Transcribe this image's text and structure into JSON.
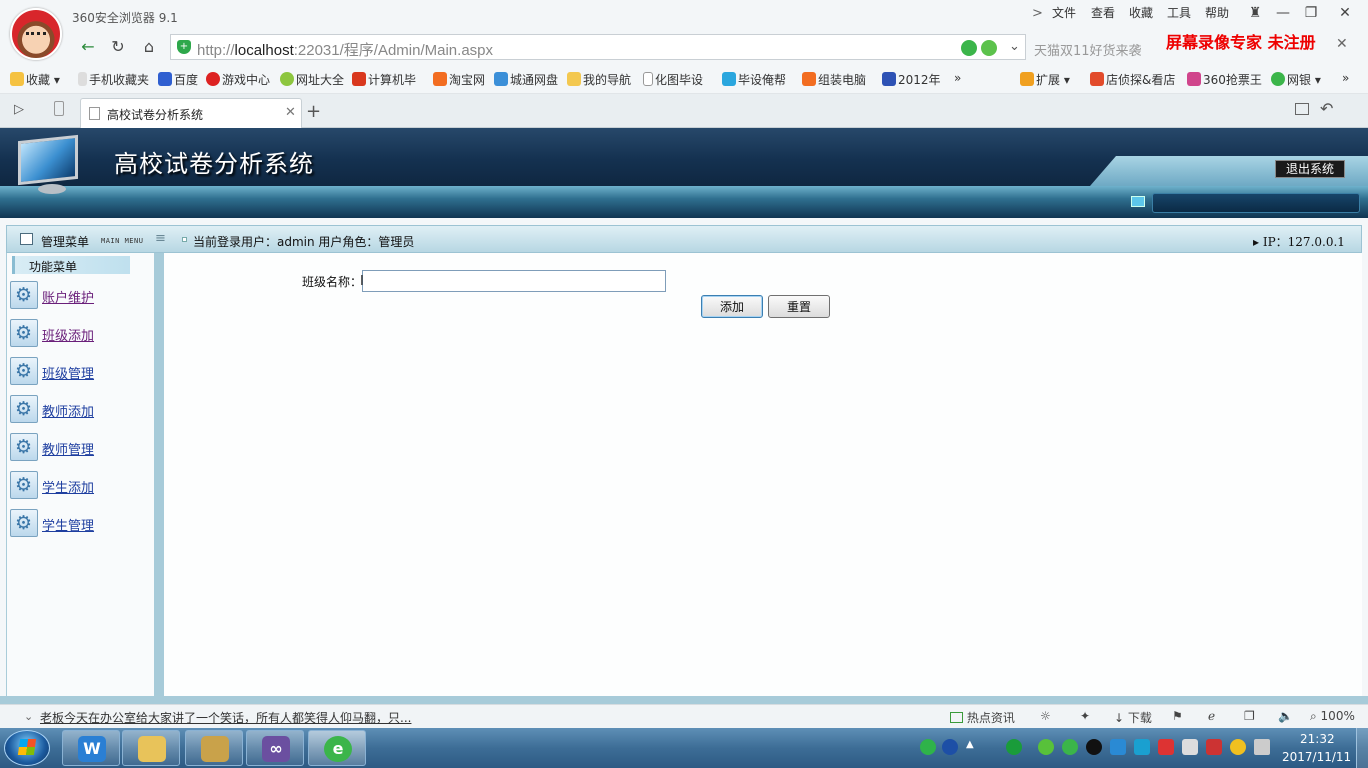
{
  "browser": {
    "title": "360安全浏览器 9.1",
    "menu": [
      "文件",
      "查看",
      "收藏",
      "工具",
      "帮助"
    ],
    "url_prefix": "http://",
    "url_host": "localhost",
    "url_rest": ":22031/程序/Admin/Main.aspx",
    "search_placeholder": "天猫双11好货来袭",
    "watermark": "屏幕录像专家  未注册",
    "bookmarks": [
      "收藏",
      "手机收藏夹",
      "百度",
      "游戏中心",
      "网址大全",
      "计算机毕",
      "淘宝网",
      "城通网盘",
      "我的导航",
      "化图毕设",
      "毕设俺帮",
      "组装电脑",
      "2012年"
    ],
    "bookmarks_right": [
      "扩展",
      "店侦探&看店",
      "360抢票王",
      "网银"
    ],
    "tab_title": "高校试卷分析系统",
    "status_news": "老板今天在办公室给大家讲了一个笑话，所有人都笑得人仰马翻，只...",
    "status_items": {
      "hot": "热点资讯",
      "download": "下载",
      "zoom": "100%"
    }
  },
  "app": {
    "title": "高校试卷分析系统",
    "logout": "退出系统",
    "menu_head": "管理菜单",
    "menu_head_en": "MAIN MENU",
    "user_info": "当前登录用户：admin  用户角色：管理员",
    "ip_info": "IP：127.0.0.1",
    "func_menu": "功能菜单",
    "sidebar_items": [
      {
        "label": "账户维护",
        "visited": true
      },
      {
        "label": "班级添加",
        "visited": true
      },
      {
        "label": "班级管理",
        "visited": false
      },
      {
        "label": "教师添加",
        "visited": false
      },
      {
        "label": "教师管理",
        "visited": false
      },
      {
        "label": "学生添加",
        "visited": false
      },
      {
        "label": "学生管理",
        "visited": false
      }
    ],
    "form": {
      "class_label": "班级名称：",
      "class_value": "",
      "add_button": "添加",
      "reset_button": "重置"
    }
  },
  "taskbar": {
    "time": "21:32",
    "date": "2017/11/11"
  }
}
